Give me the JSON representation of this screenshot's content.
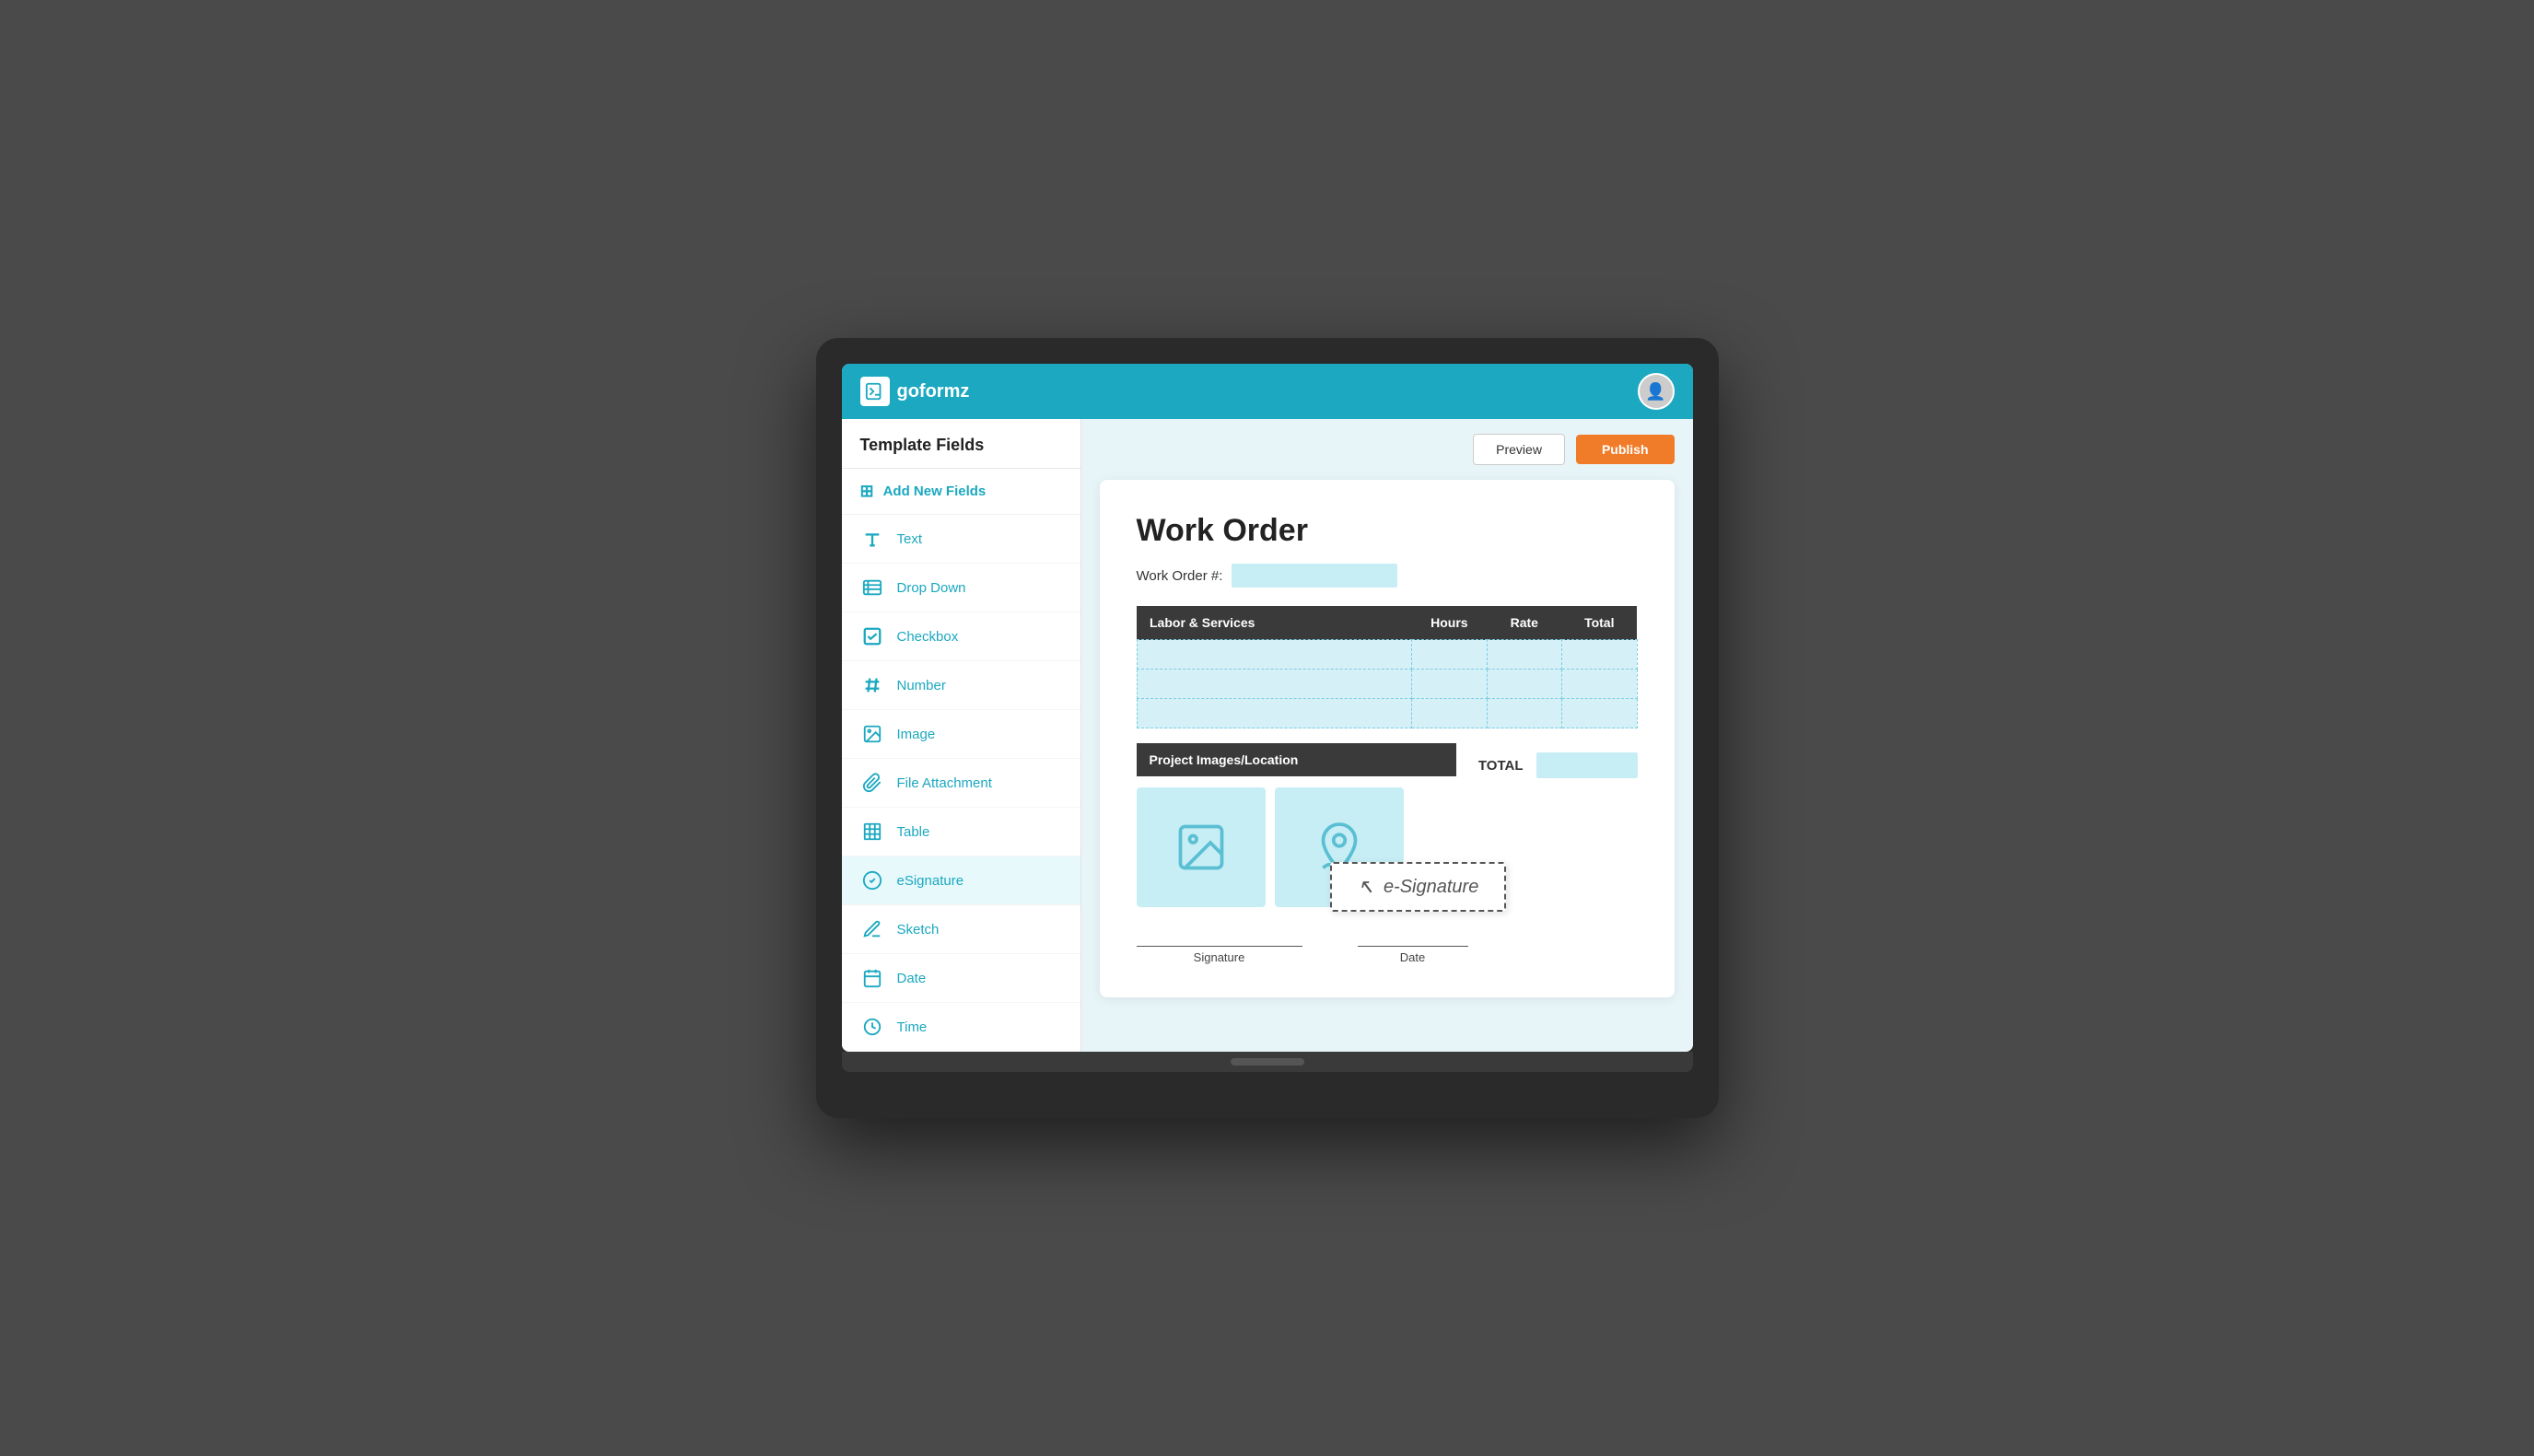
{
  "app": {
    "name": "goformz",
    "logo_alt": "goformz logo"
  },
  "header": {
    "preview_label": "Preview",
    "publish_label": "Publish"
  },
  "sidebar": {
    "title": "Template Fields",
    "add_new_label": "Add New Fields",
    "items": [
      {
        "id": "text",
        "label": "Text",
        "icon": "T"
      },
      {
        "id": "dropdown",
        "label": "Drop Down",
        "icon": "dropdown"
      },
      {
        "id": "checkbox",
        "label": "Checkbox",
        "icon": "checkbox"
      },
      {
        "id": "number",
        "label": "Number",
        "icon": "#"
      },
      {
        "id": "image",
        "label": "Image",
        "icon": "image"
      },
      {
        "id": "file-attachment",
        "label": "File Attachment",
        "icon": "clip"
      },
      {
        "id": "table",
        "label": "Table",
        "icon": "table"
      },
      {
        "id": "esignature",
        "label": "eSignature",
        "icon": "esig"
      },
      {
        "id": "sketch",
        "label": "Sketch",
        "icon": "pencil"
      },
      {
        "id": "date",
        "label": "Date",
        "icon": "cal"
      },
      {
        "id": "time",
        "label": "Time",
        "icon": "clock"
      }
    ]
  },
  "form": {
    "title": "Work Order",
    "work_order_label": "Work Order #:",
    "table": {
      "headers": [
        "Labor & Services",
        "Hours",
        "Rate",
        "Total"
      ],
      "rows": 3
    },
    "project_section": {
      "header": "Project Images/Location"
    },
    "total_label": "TOTAL",
    "signature_label": "Signature",
    "date_label": "Date"
  },
  "drag_tooltip": {
    "text": "e-Signature"
  }
}
